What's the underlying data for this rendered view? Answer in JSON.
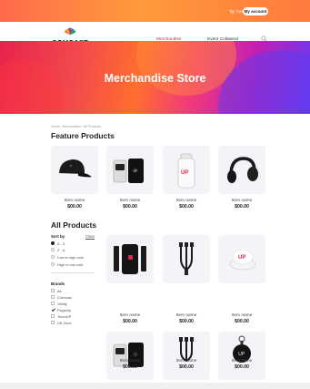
{
  "topbar": {
    "cart_label": "Cart",
    "account_label": "My account"
  },
  "nav": {
    "logo_text": "COMCAST",
    "links": [
      "Merchandise",
      "Event Collateral"
    ],
    "active_link": "Merchandise"
  },
  "hero": {
    "title": "Merchandise Store"
  },
  "breadcrumb": "Home  /  Merchandise  /  All Products",
  "featured": {
    "title": "Feature Products",
    "items": [
      {
        "name": "Item name",
        "price": "$00.00",
        "icon": "cap-icon"
      },
      {
        "name": "Item name",
        "price": "$00.00",
        "icon": "phone-wallet-icon"
      },
      {
        "name": "Item name",
        "price": "$00.00",
        "icon": "water-bottle-icon"
      },
      {
        "name": "Item name",
        "price": "$00.00",
        "icon": "headphones-icon"
      }
    ]
  },
  "all_products": {
    "title": "All Products",
    "items": [
      {
        "name": "Item name",
        "price": "$00.00",
        "icon": "power-bank-icon"
      },
      {
        "name": "Item name",
        "price": "$00.00",
        "icon": "multi-cable-icon"
      },
      {
        "name": "Item name",
        "price": "$00.00",
        "icon": "phone-grip-icon"
      },
      {
        "name": "Item name",
        "price": "$00.00",
        "icon": "phone-wallet-icon"
      },
      {
        "name": "Item name",
        "price": "$00.00",
        "icon": "multi-cable-icon"
      },
      {
        "name": "Item name",
        "price": "$00.00",
        "icon": "tracker-keyring-icon"
      }
    ]
  },
  "sidebar": {
    "sort_label": "Sort by",
    "clear_label": "Clear",
    "sort_options": [
      {
        "label": "A - Z",
        "selected": true
      },
      {
        "label": "Z - A",
        "selected": false
      },
      {
        "label": "Low to high cost",
        "selected": false
      },
      {
        "label": "High to low cost",
        "selected": false
      }
    ],
    "brands_label": "Brands",
    "brand_options": [
      {
        "label": "All",
        "checked": false
      },
      {
        "label": "Comcast",
        "checked": false
      },
      {
        "label": "Xfinity",
        "checked": false
      },
      {
        "label": "Flagship",
        "checked": true
      },
      {
        "label": "TeamUP",
        "checked": false
      },
      {
        "label": "Lift Zone",
        "checked": false
      }
    ]
  },
  "colors": {
    "accent": "#d11f4b",
    "topbar": "#ff8a40",
    "card_bg": "#f3f4f7"
  }
}
